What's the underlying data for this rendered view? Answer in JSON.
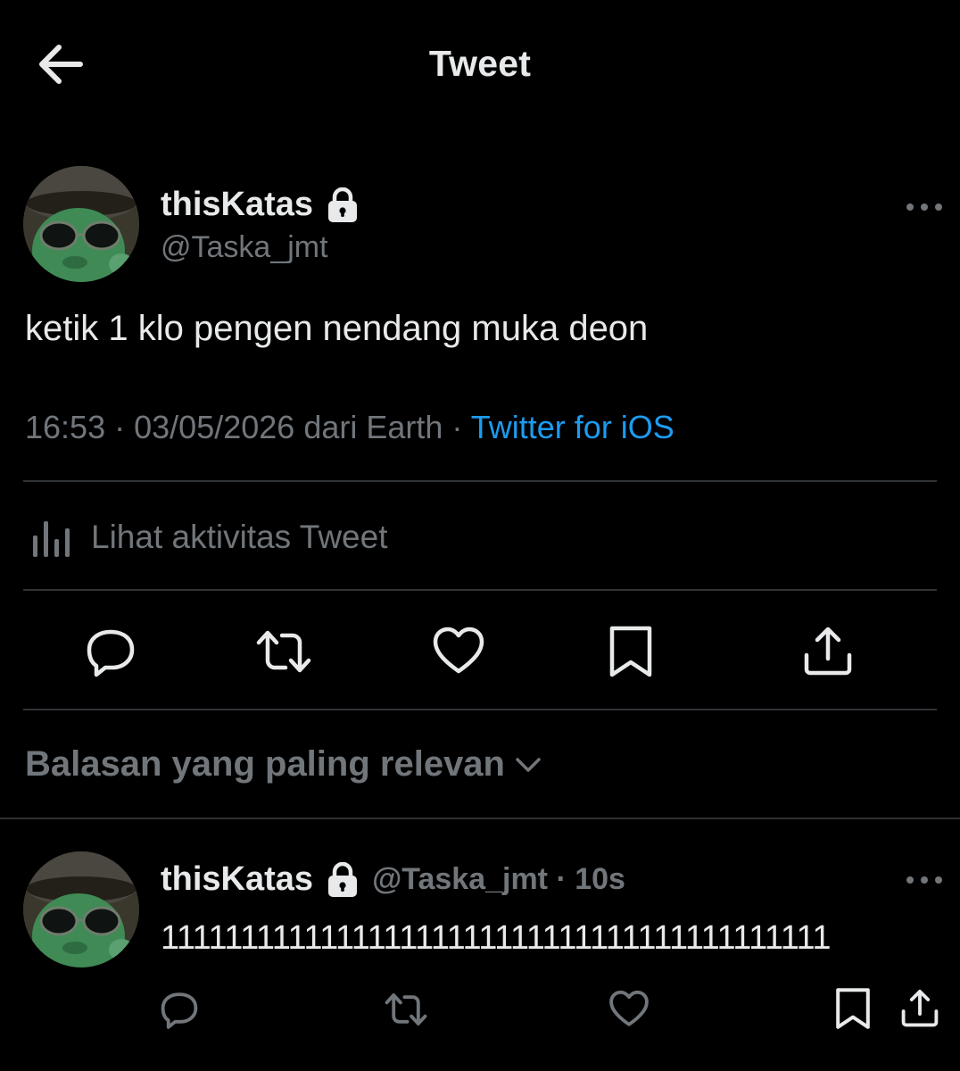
{
  "header": {
    "title": "Tweet",
    "back_icon": "arrow-left-icon"
  },
  "tweet": {
    "display_name": "thisKatas",
    "handle": "@Taska_jmt",
    "locked_icon": "lock-icon",
    "text": "ketik 1 klo pengen nendang muka deon",
    "time": "16:53",
    "date": "03/05/2026",
    "location_prefix": "dari Earth",
    "separator": "·",
    "source": "Twitter for iOS",
    "activity_label": "Lihat aktivitas Tweet"
  },
  "actions": [
    "reply-icon",
    "retweet-icon",
    "like-icon",
    "bookmark-icon",
    "share-icon"
  ],
  "replies": {
    "sort_label": "Balasan yang paling relevan",
    "items": [
      {
        "display_name": "thisKatas",
        "handle_time": "@Taska_jmt · 10s",
        "text": "111111111111111111111111111111111111111111"
      }
    ]
  },
  "colors": {
    "background": "#000000",
    "primary_text": "#e7e9ea",
    "secondary_text": "#71767b",
    "link": "#1d9bf0",
    "divider": "#2f3336"
  }
}
